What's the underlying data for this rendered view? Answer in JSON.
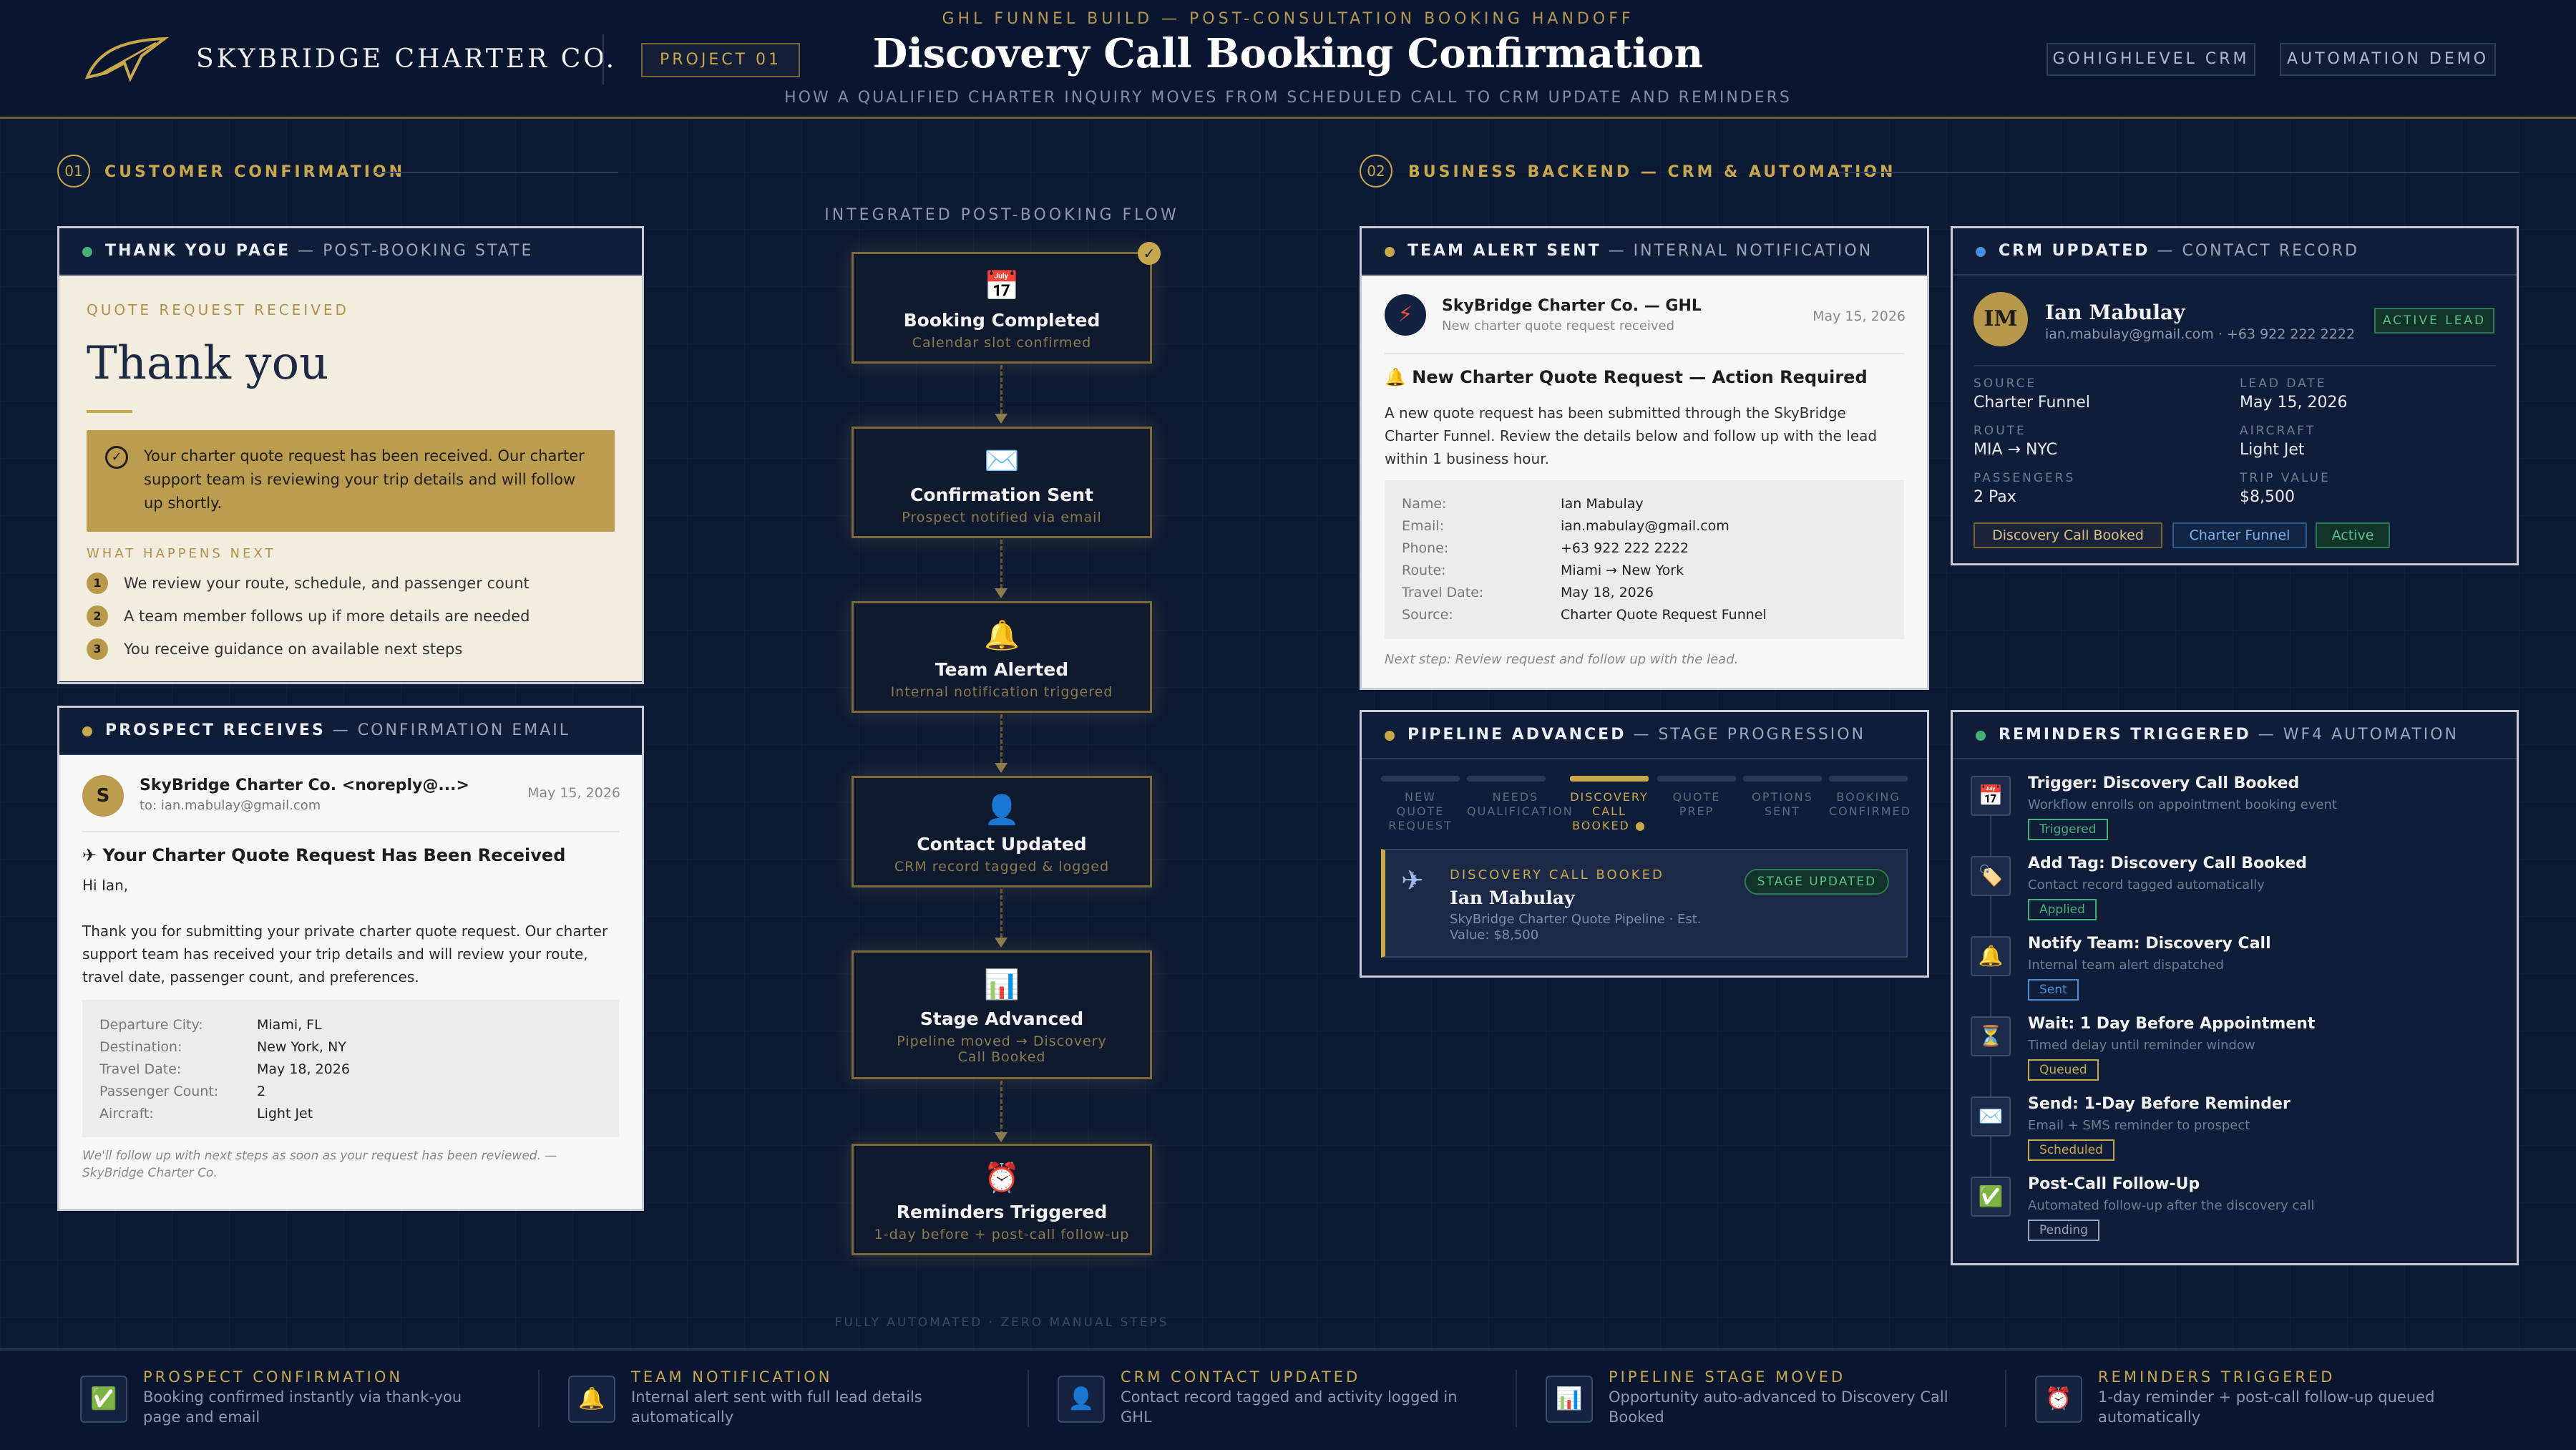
{
  "header": {
    "brand": "SKYBRIDGE CHARTER CO.",
    "project": "PROJECT 01",
    "kicker": "GHL FUNNEL BUILD — POST-CONSULTATION BOOKING HANDOFF",
    "title": "Discovery Call Booking Confirmation",
    "subtitle": "HOW A QUALIFIED CHARTER INQUIRY MOVES FROM SCHEDULED CALL TO CRM UPDATE AND REMINDERS",
    "tags": [
      "GOHIGHLEVEL CRM",
      "AUTOMATION DEMO"
    ]
  },
  "sections": {
    "s1_num": "01",
    "s1_label": "CUSTOMER CONFIRMATION",
    "s2_num": "02",
    "s2_label": "BUSINESS BACKEND — CRM & AUTOMATION"
  },
  "thankyou": {
    "head_bold": "THANK YOU PAGE",
    "head_rest": " — POST-BOOKING STATE",
    "kicker": "QUOTE REQUEST RECEIVED",
    "big": "Thank you",
    "message": "Your charter quote request has been received. Our charter support team is reviewing your trip details and will follow up shortly.",
    "next_label": "WHAT HAPPENS NEXT",
    "steps": [
      {
        "n": "1",
        "text": "We review your route, schedule, and passenger count"
      },
      {
        "n": "2",
        "text": "A team member follows up if more details are needed"
      },
      {
        "n": "3",
        "text": "You receive guidance on available next steps"
      }
    ]
  },
  "prospect_email": {
    "head_bold": "PROSPECT RECEIVES",
    "head_rest": " — CONFIRMATION EMAIL",
    "avatar": "S",
    "from": "SkyBridge Charter Co. <noreply@...>",
    "to": "to: ian.mabulay@gmail.com",
    "date": "May 15, 2026",
    "subject": "✈ Your Charter Quote Request Has Been Received",
    "greeting": "Hi Ian,",
    "body": "Thank you for submitting your private charter quote request. Our charter support team has received your trip details and will review your route, travel date, passenger count, and preferences.",
    "details": [
      {
        "label": "Departure City:",
        "value": "Miami, FL"
      },
      {
        "label": "Destination:",
        "value": "New York, NY"
      },
      {
        "label": "Travel Date:",
        "value": "May 18, 2026"
      },
      {
        "label": "Passenger Count:",
        "value": "2"
      },
      {
        "label": "Aircraft:",
        "value": "Light Jet"
      }
    ],
    "footer": "We'll follow up with next steps as soon as your request has been reviewed. — SkyBridge Charter Co."
  },
  "flow": {
    "title": "INTEGRATED POST-BOOKING FLOW",
    "footer": "FULLY AUTOMATED · ZERO MANUAL STEPS",
    "nodes": [
      {
        "icon": "calendar-icon",
        "glyph": "📅",
        "title": "Booking Completed",
        "sub": "Calendar slot confirmed"
      },
      {
        "icon": "envelope-icon",
        "glyph": "✉️",
        "title": "Confirmation Sent",
        "sub": "Prospect notified via email"
      },
      {
        "icon": "bell-icon",
        "glyph": "🔔",
        "title": "Team Alerted",
        "sub": "Internal notification triggered"
      },
      {
        "icon": "person-icon",
        "glyph": "👤",
        "title": "Contact Updated",
        "sub": "CRM record tagged & logged"
      },
      {
        "icon": "chart-icon",
        "glyph": "📊",
        "title": "Stage Advanced",
        "sub": "Pipeline moved → Discovery Call Booked"
      },
      {
        "icon": "alarm-icon",
        "glyph": "⏰",
        "title": "Reminders Triggered",
        "sub": "1-day before + post-call follow-up"
      }
    ]
  },
  "team_alert": {
    "head_bold": "TEAM ALERT SENT",
    "head_rest": " — INTERNAL NOTIFICATION",
    "from": "SkyBridge Charter Co. — GHL",
    "sub": "New charter quote request received",
    "date": "May 15, 2026",
    "subject": "🔔 New Charter Quote Request — Action Required",
    "body": "A new quote request has been submitted through the SkyBridge Charter Funnel. Review the details below and follow up with the lead within 1 business hour.",
    "details": [
      {
        "label": "Name:",
        "value": "Ian Mabulay"
      },
      {
        "label": "Email:",
        "value": "ian.mabulay@gmail.com"
      },
      {
        "label": "Phone:",
        "value": "+63 922 222 2222"
      },
      {
        "label": "Route:",
        "value": "Miami → New York"
      },
      {
        "label": "Travel Date:",
        "value": "May 18, 2026"
      },
      {
        "label": "Source:",
        "value": "Charter Quote Request Funnel"
      }
    ],
    "next": "Next step: Review request and follow up with the lead."
  },
  "crm": {
    "head_bold": "CRM UPDATED",
    "head_rest": " — CONTACT RECORD",
    "initials": "IM",
    "name": "Ian Mabulay",
    "contact": "ian.mabulay@gmail.com · +63 922 222 2222",
    "status": "ACTIVE LEAD",
    "fields": [
      {
        "label": "SOURCE",
        "value": "Charter Funnel"
      },
      {
        "label": "LEAD DATE",
        "value": "May 15, 2026"
      },
      {
        "label": "ROUTE",
        "value": "MIA → NYC"
      },
      {
        "label": "AIRCRAFT",
        "value": "Light Jet"
      },
      {
        "label": "PASSENGERS",
        "value": "2 Pax"
      },
      {
        "label": "TRIP VALUE",
        "value": "$8,500"
      }
    ],
    "tags": [
      "Discovery Call Booked",
      "Charter Funnel",
      "Active"
    ]
  },
  "pipeline": {
    "head_bold": "PIPELINE ADVANCED",
    "head_rest": " — STAGE PROGRESSION",
    "stages": [
      "NEW QUOTE REQUEST",
      "NEEDS QUALIFICATION",
      "DISCOVERY CALL BOOKED ●",
      "QUOTE PREP",
      "OPTIONS SENT",
      "BOOKING CONFIRMED"
    ],
    "card_kicker": "DISCOVERY CALL BOOKED",
    "card_name": "Ian Mabulay",
    "card_sub": "SkyBridge Charter Quote Pipeline · Est. Value: $8,500",
    "card_badge": "STAGE UPDATED"
  },
  "reminders": {
    "head_bold": "REMINDERS TRIGGERED",
    "head_rest": " — WF4 AUTOMATION",
    "items": [
      {
        "icon": "calendar-icon",
        "glyph": "📅",
        "title": "Trigger: Discovery Call Booked",
        "sub": "Workflow enrolls on appointment booking event",
        "badge": "Triggered",
        "color": "#46b07a"
      },
      {
        "icon": "tag-icon",
        "glyph": "🏷️",
        "title": "Add Tag: Discovery Call Booked",
        "sub": "Contact record tagged automatically",
        "badge": "Applied",
        "color": "#46b07a"
      },
      {
        "icon": "bell-icon",
        "glyph": "🔔",
        "title": "Notify Team: Discovery Call",
        "sub": "Internal team alert dispatched",
        "badge": "Sent",
        "color": "#4c8fd8"
      },
      {
        "icon": "hourglass-icon",
        "glyph": "⏳",
        "title": "Wait: 1 Day Before Appointment",
        "sub": "Timed delay until reminder window",
        "badge": "Queued",
        "color": "#c9a74d"
      },
      {
        "icon": "envelope-icon",
        "glyph": "✉️",
        "title": "Send: 1-Day Before Reminder",
        "sub": "Email + SMS reminder to prospect",
        "badge": "Scheduled",
        "color": "#c9a74d"
      },
      {
        "icon": "check-icon",
        "glyph": "✅",
        "title": "Post-Call Follow-Up",
        "sub": "Automated follow-up after the discovery call",
        "badge": "Pending",
        "color": "#9aa3b5"
      }
    ]
  },
  "footer": [
    {
      "icon": "check-icon",
      "glyph": "✅",
      "title": "PROSPECT CONFIRMATION",
      "desc": "Booking confirmed instantly via thank-you page and email"
    },
    {
      "icon": "bell-icon",
      "glyph": "🔔",
      "title": "TEAM NOTIFICATION",
      "desc": "Internal alert sent with full lead details automatically"
    },
    {
      "icon": "person-icon",
      "glyph": "👤",
      "title": "CRM CONTACT UPDATED",
      "desc": "Contact record tagged and activity logged in GHL"
    },
    {
      "icon": "chart-icon",
      "glyph": "📊",
      "title": "PIPELINE STAGE MOVED",
      "desc": "Opportunity auto-advanced to Discovery Call Booked"
    },
    {
      "icon": "alarm-icon",
      "glyph": "⏰",
      "title": "REMINDERS TRIGGERED",
      "desc": "1-day reminder + post-call follow-up queued automatically"
    }
  ],
  "colors": {
    "gold": "#c9a74d",
    "navy": "#0d1a33",
    "green": "#46b07a",
    "blue": "#4c8fd8"
  }
}
